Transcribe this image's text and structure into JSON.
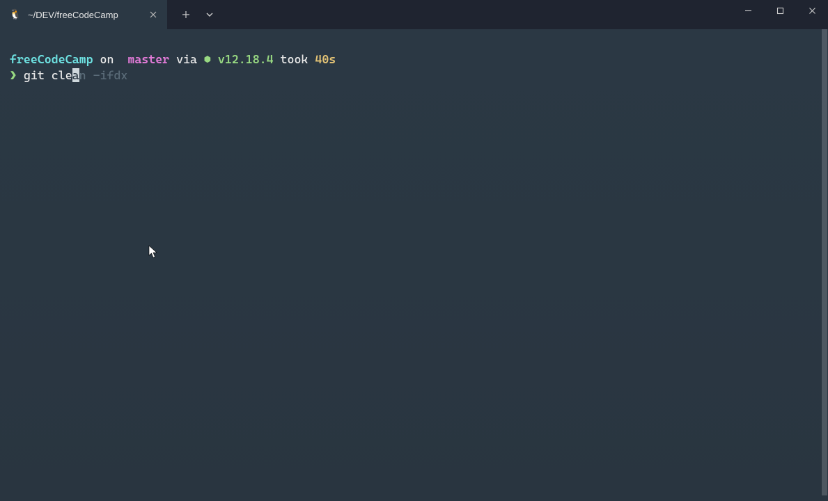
{
  "window": {
    "tab": {
      "title": "~/DEV/freeCodeCamp",
      "icon": "🐧"
    }
  },
  "prompt": {
    "directory": "freeCodeCamp",
    "on_text": "on",
    "branch_icon": "",
    "branch": "master",
    "via_text": "via",
    "node_icon": "⬢",
    "node_version": "v12.18.4",
    "took_text": "took",
    "took_duration": "40s",
    "symbol": "❯",
    "typed_command": "git cle",
    "suggestion_pre_cursor": "a",
    "suggestion_post_cursor": "n -ifdx"
  }
}
